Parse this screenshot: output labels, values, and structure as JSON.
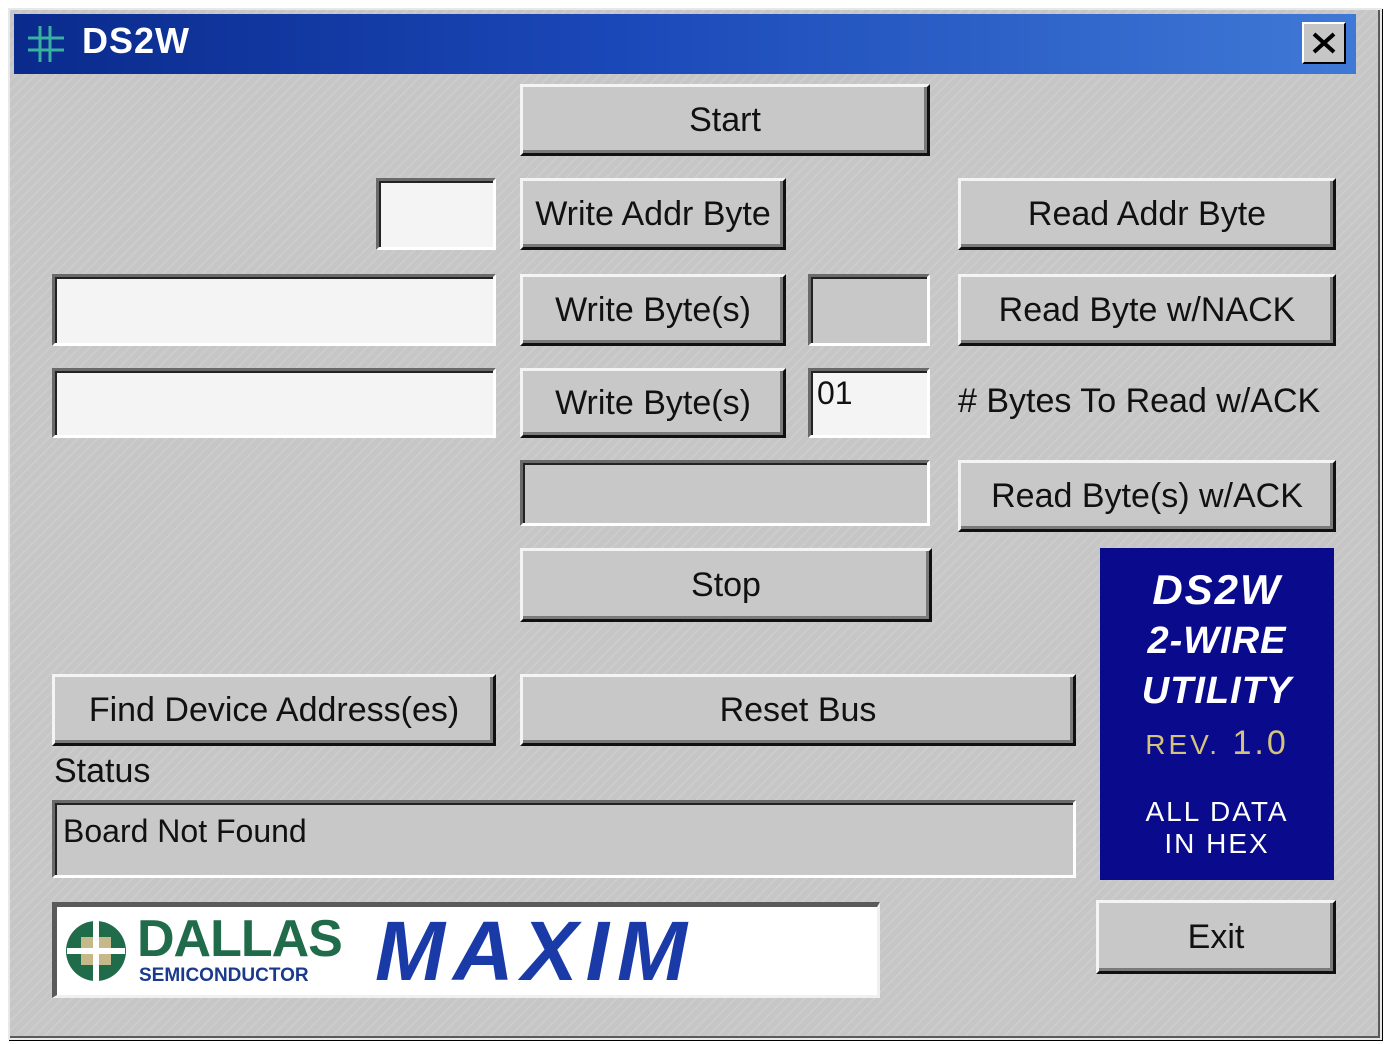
{
  "window": {
    "title": "DS2W"
  },
  "buttons": {
    "start": "Start",
    "write_addr_byte": "Write Addr Byte",
    "read_addr_byte": "Read Addr Byte",
    "write_bytes_1": "Write Byte(s)",
    "read_byte_nack": "Read Byte w/NACK",
    "write_bytes_2": "Write Byte(s)",
    "read_bytes_ack": "Read Byte(s) w/ACK",
    "stop": "Stop",
    "find_device": "Find Device Address(es)",
    "reset_bus": "Reset Bus",
    "exit": "Exit"
  },
  "fields": {
    "addr_input": "",
    "write_data_1": "",
    "write_data_2": "",
    "read_nack_result": "",
    "bytes_to_read": "01",
    "read_ack_result": ""
  },
  "labels": {
    "bytes_to_read": "# Bytes To Read w/ACK",
    "status": "Status"
  },
  "status": {
    "value": "Board Not Found"
  },
  "info_box": {
    "line1": "DS2W",
    "line2": "2-WIRE",
    "line3": "UTILITY",
    "rev_label": "REV.",
    "rev_value": "1.0",
    "note1": "ALL DATA",
    "note2": "IN HEX"
  },
  "logo": {
    "dallas": "DALLAS",
    "semiconductor": "SEMICONDUCTOR",
    "maxim": "MAXIM"
  },
  "colors": {
    "titlebar_start": "#0a2a8c",
    "titlebar_end": "#3f79d6",
    "info_box_bg": "#0a0a8c",
    "rev_color": "#d4c37a",
    "dallas_green": "#1f6b4a",
    "dallas_blue": "#1a3a8c",
    "maxim_blue": "#1a3aa8"
  },
  "icons": {
    "app": "ds2w-app-icon",
    "close": "close-icon",
    "dallas_logo_mark": "dallas-chip-icon"
  }
}
